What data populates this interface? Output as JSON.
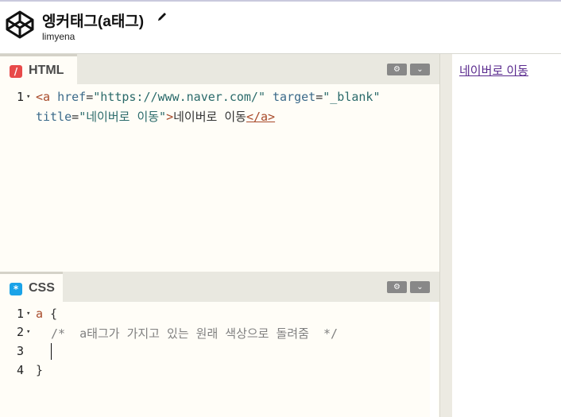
{
  "header": {
    "title": "엥커태그(a태그)",
    "username": "limyena"
  },
  "html_pane": {
    "tab_label": "HTML",
    "badge_glyph": "/",
    "badge_color": "#e84a4a",
    "lines": [
      {
        "num": "1",
        "fold": "▾"
      }
    ],
    "code": {
      "open_lt": "<",
      "a_tag": "a",
      "href_attr": " href",
      "eq1": "=",
      "href_val": "\"https://www.naver.com/\"",
      "target_attr": " target",
      "eq2": "=",
      "target_val": "\"_blank\"",
      "title_attr": "title",
      "eq3": "=",
      "title_val": "\"네이버로 이동\"",
      "gt": ">",
      "link_text": "네이버로 이동",
      "close_tag": "</a>"
    }
  },
  "css_pane": {
    "tab_label": "CSS",
    "badge_glyph": "*",
    "badge_color": "#1aa3e8",
    "lines": [
      {
        "num": "1",
        "fold": "▾"
      },
      {
        "num": "2",
        "fold": "▾"
      },
      {
        "num": "3",
        "fold": ""
      },
      {
        "num": "4",
        "fold": ""
      }
    ],
    "code": {
      "selector": "a",
      "open_brace": " {",
      "comment": "/*  a태그가 가지고 있는 원래 색상으로 돌려줌  */",
      "close_brace": "}"
    }
  },
  "preview": {
    "link_text": "네이버로 이동"
  },
  "icons": {
    "settings": "gear-icon",
    "collapse": "chevron-down-icon",
    "edit": "pencil-icon",
    "logo": "codepen-logo-icon"
  }
}
